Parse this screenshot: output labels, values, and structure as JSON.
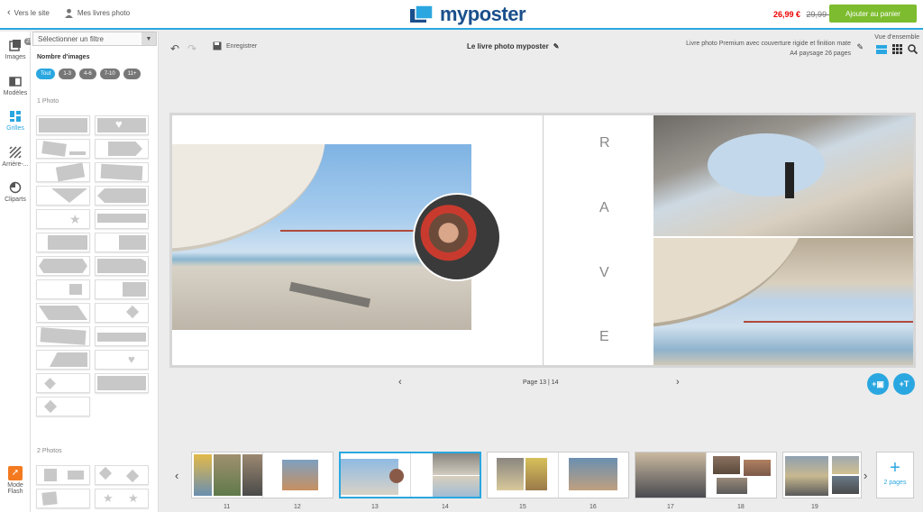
{
  "header": {
    "back_link": "Vers le site",
    "my_books": "Mes livres photo",
    "logo": "myposter",
    "price_new": "26,99 €",
    "price_old": "29,99 €",
    "cart_button": "Ajouter au panier",
    "accent": "#2aa7e0",
    "cart_color": "#7cbc2e"
  },
  "nav": [
    {
      "label": "Images",
      "badge": "252",
      "icon": "images-icon"
    },
    {
      "label": "Modèles",
      "icon": "layout-icon"
    },
    {
      "label": "Grilles",
      "icon": "grid-icon",
      "active": true
    },
    {
      "label": "Arrière-...",
      "icon": "background-icon"
    },
    {
      "label": "Cliparts",
      "icon": "clipart-icon"
    }
  ],
  "mode_flash": {
    "line1": "Mode",
    "line2": "Flash"
  },
  "panel": {
    "filter_placeholder": "Sélectionner un filtre",
    "count_title": "Nombre d'images",
    "chips": [
      "Tout",
      "1-3",
      "4-6",
      "7-10",
      "11+"
    ],
    "section_1": "1 Photo",
    "section_2": "2 Photos"
  },
  "toolbar": {
    "save": "Enregistrer",
    "title": "Le livre photo myposter",
    "product_line1": "Livre photo Premium avec couverture rigide et finition mate",
    "product_line2": "A4 paysage 26 pages",
    "overview": "Vue d'ensemble"
  },
  "spread": {
    "letters": [
      "R",
      "A",
      "V",
      "E"
    ]
  },
  "pager": {
    "label": "Page 13 | 14"
  },
  "fabs": {
    "add_image": "+▣",
    "add_text": "+T"
  },
  "strip": {
    "pages": [
      "11",
      "12",
      "13",
      "14",
      "15",
      "16",
      "17",
      "18",
      "19"
    ],
    "add_pages": "2 pages",
    "add_symbol": "+"
  }
}
